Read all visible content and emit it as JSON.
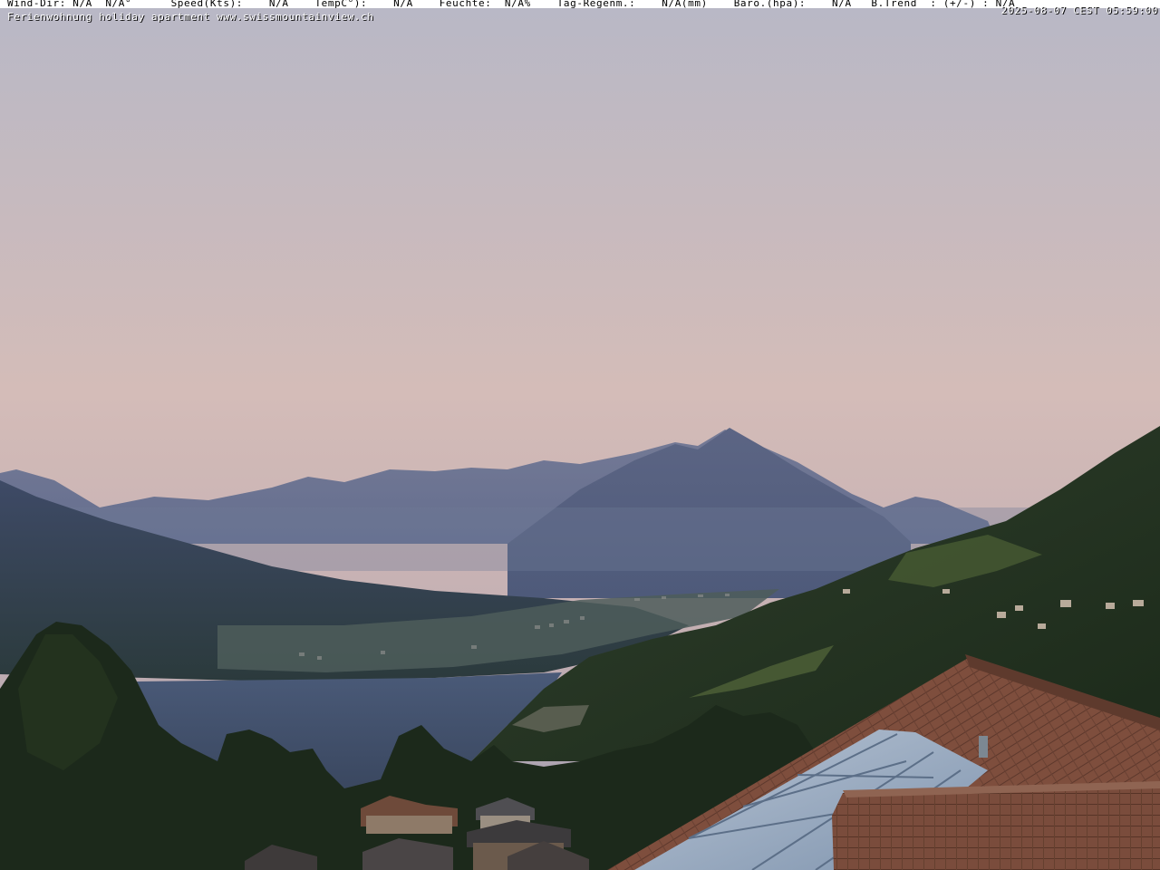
{
  "overlay": {
    "weather_line": "Wind-Dir: N/A  N/A°      Speed(Kts):    N/A    TempC°):    N/A    Feuchte:  N/A%    Tag-Regenm.:    N/A(mm)    Baro.(hpa):    N/A   B.Trend  : (+/-) : N/A",
    "caption": "Ferienwohnung holiday apartment www.swissmountainview.ch",
    "timestamp": "2025-08-07 CEST 05:59:00"
  },
  "colors": {
    "sky_top": "#b7b7c4",
    "sky_mid": "#d6bcb5",
    "sky_horizon": "#a29eb0",
    "far_ridge": "#5d6a8a",
    "pyramid_peak": "#56607d",
    "valley_haze": "#4a5878",
    "lake": "#3f4d68",
    "forest": "#22331f",
    "roof": "#7e4f3e",
    "solar_panel": "#8aa0b8"
  },
  "icons": {
    "scene": "mountain-lake-webcam"
  }
}
